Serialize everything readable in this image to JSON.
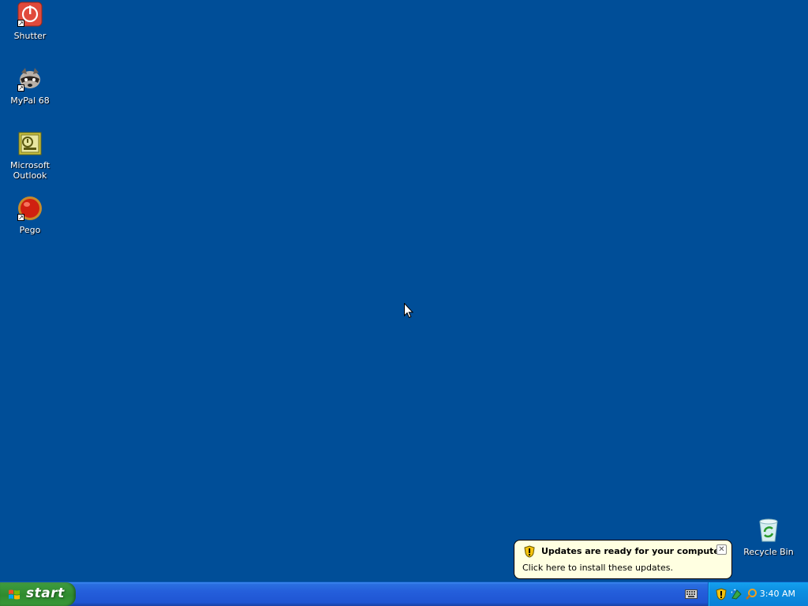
{
  "desktop": {
    "icons": [
      {
        "label": "Shutter",
        "icon": "power-icon"
      },
      {
        "label": "MyPal 68",
        "icon": "raccoon-icon"
      },
      {
        "label": "Microsoft Outlook",
        "icon": "outlook-icon"
      },
      {
        "label": "Pego",
        "icon": "red-ball-icon"
      },
      {
        "label": "Recycle Bin",
        "icon": "recycle-bin-icon"
      }
    ]
  },
  "balloon": {
    "title": "Updates are ready for your computer",
    "text": "Click here to install these updates.",
    "close": "✕"
  },
  "taskbar": {
    "start_label": "start",
    "clock": "3:40 AM",
    "tray_icons": [
      "windows-update-shield-icon",
      "network-icon",
      "search-icon"
    ]
  },
  "colors": {
    "desktop": "#004e98",
    "taskbar": "#245edb",
    "start": "#3c9a3c",
    "tray": "#0c8ee0",
    "balloon": "#ffffe1"
  }
}
